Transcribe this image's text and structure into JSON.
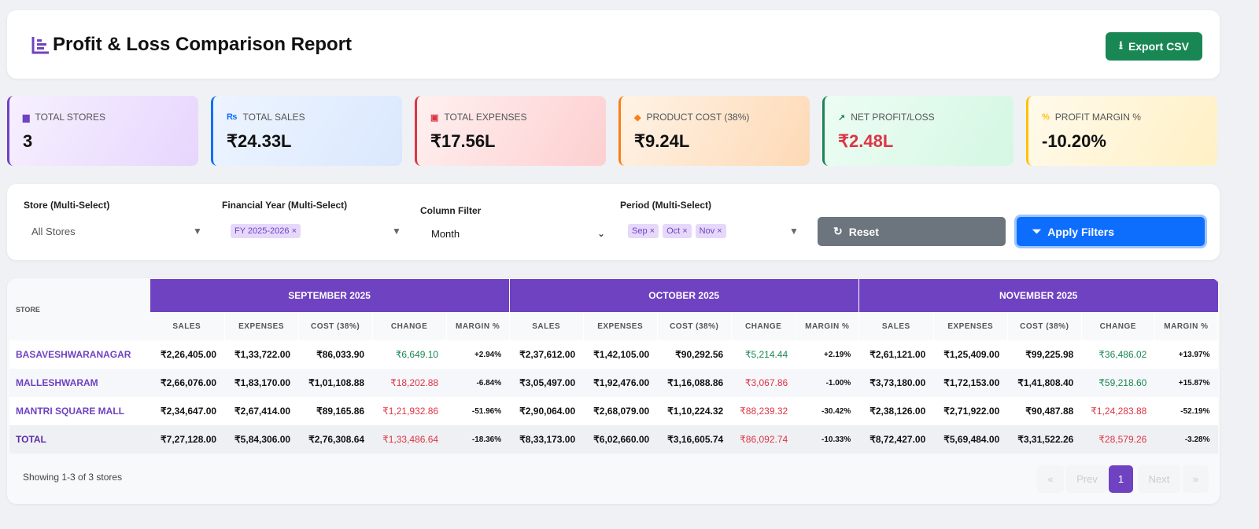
{
  "header": {
    "title": "Profit & Loss Comparison Report",
    "export_label": "Export CSV"
  },
  "stats": [
    {
      "label": "TOTAL STORES",
      "value": "3",
      "icon": "store-icon",
      "color": "#6f42c1",
      "bg": "linear-gradient(120deg,#f7f0ff,#e6d6fd)"
    },
    {
      "label": "TOTAL SALES",
      "value": "₹24.33L",
      "icon": "rupee-icon",
      "color": "#0d6efd",
      "bg": "linear-gradient(120deg,#edf4ff,#dae8fd)"
    },
    {
      "label": "TOTAL EXPENSES",
      "value": "₹17.56L",
      "icon": "money-icon",
      "color": "#dc3545",
      "bg": "linear-gradient(120deg,#fff0f0,#fdcfd0)"
    },
    {
      "label": "PRODUCT COST (38%)",
      "value": "₹9.24L",
      "icon": "tag-icon",
      "color": "#fd7e14",
      "bg": "linear-gradient(120deg,#fff3e6,#fdd9b5)"
    },
    {
      "label": "NET PROFIT/LOSS",
      "value": "₹2.48L",
      "icon": "chart-line-icon",
      "color": "#198754",
      "bg": "linear-gradient(120deg,#edfdf4,#d4f7e3)"
    },
    {
      "label": "PROFIT MARGIN %",
      "value": "-10.20%",
      "icon": "percent-icon",
      "color": "#ffc107",
      "bg": "linear-gradient(120deg,#fffaeb,#fff0c4)"
    }
  ],
  "filters": {
    "store_label": "Store (Multi-Select)",
    "store_value": "All Stores",
    "fy_label": "Financial Year (Multi-Select)",
    "fy_chips": [
      "FY 2025-2026 ×"
    ],
    "column_label": "Column Filter",
    "column_value": "Month",
    "period_label": "Period (Multi-Select)",
    "period_chips": [
      "Sep ×",
      "Oct ×",
      "Nov ×"
    ],
    "reset_label": "Reset",
    "apply_label": "Apply Filters"
  },
  "table": {
    "store_header": "STORE",
    "sub_headers": [
      "SALES",
      "EXPENSES",
      "COST (38%)",
      "CHANGE",
      "MARGIN %"
    ],
    "periods": [
      "SEPTEMBER 2025",
      "OCTOBER 2025",
      "NOVEMBER 2025"
    ],
    "rows": [
      {
        "store": "BASAVESHWARANAGAR",
        "cells": [
          [
            "₹2,26,405.00",
            "₹1,33,722.00",
            "₹86,033.90",
            "₹6,649.10",
            "+2.94%"
          ],
          [
            "₹2,37,612.00",
            "₹1,42,105.00",
            "₹90,292.56",
            "₹5,214.44",
            "+2.19%"
          ],
          [
            "₹2,61,121.00",
            "₹1,25,409.00",
            "₹99,225.98",
            "₹36,486.02",
            "+13.97%"
          ]
        ]
      },
      {
        "store": "MALLESHWARAM",
        "cells": [
          [
            "₹2,66,076.00",
            "₹1,83,170.00",
            "₹1,01,108.88",
            "₹18,202.88",
            "-6.84%"
          ],
          [
            "₹3,05,497.00",
            "₹1,92,476.00",
            "₹1,16,088.86",
            "₹3,067.86",
            "-1.00%"
          ],
          [
            "₹3,73,180.00",
            "₹1,72,153.00",
            "₹1,41,808.40",
            "₹59,218.60",
            "+15.87%"
          ]
        ]
      },
      {
        "store": "MANTRI SQUARE MALL",
        "cells": [
          [
            "₹2,34,647.00",
            "₹2,67,414.00",
            "₹89,165.86",
            "₹1,21,932.86",
            "-51.96%"
          ],
          [
            "₹2,90,064.00",
            "₹2,68,079.00",
            "₹1,10,224.32",
            "₹88,239.32",
            "-30.42%"
          ],
          [
            "₹2,38,126.00",
            "₹2,71,922.00",
            "₹90,487.88",
            "₹1,24,283.88",
            "-52.19%"
          ]
        ]
      },
      {
        "store": "TOTAL",
        "cells": [
          [
            "₹7,27,128.00",
            "₹5,84,306.00",
            "₹2,76,308.64",
            "₹1,33,486.64",
            "-18.36%"
          ],
          [
            "₹8,33,173.00",
            "₹6,02,660.00",
            "₹3,16,605.74",
            "₹86,092.74",
            "-10.33%"
          ],
          [
            "₹8,72,427.00",
            "₹5,69,484.00",
            "₹3,31,522.26",
            "₹28,579.26",
            "-3.28%"
          ]
        ]
      }
    ]
  },
  "footer": {
    "showing": "Showing 1-3 of 3 stores",
    "pagination": [
      "«",
      "Prev",
      "1",
      "Next",
      "»"
    ],
    "current_page": "1"
  }
}
